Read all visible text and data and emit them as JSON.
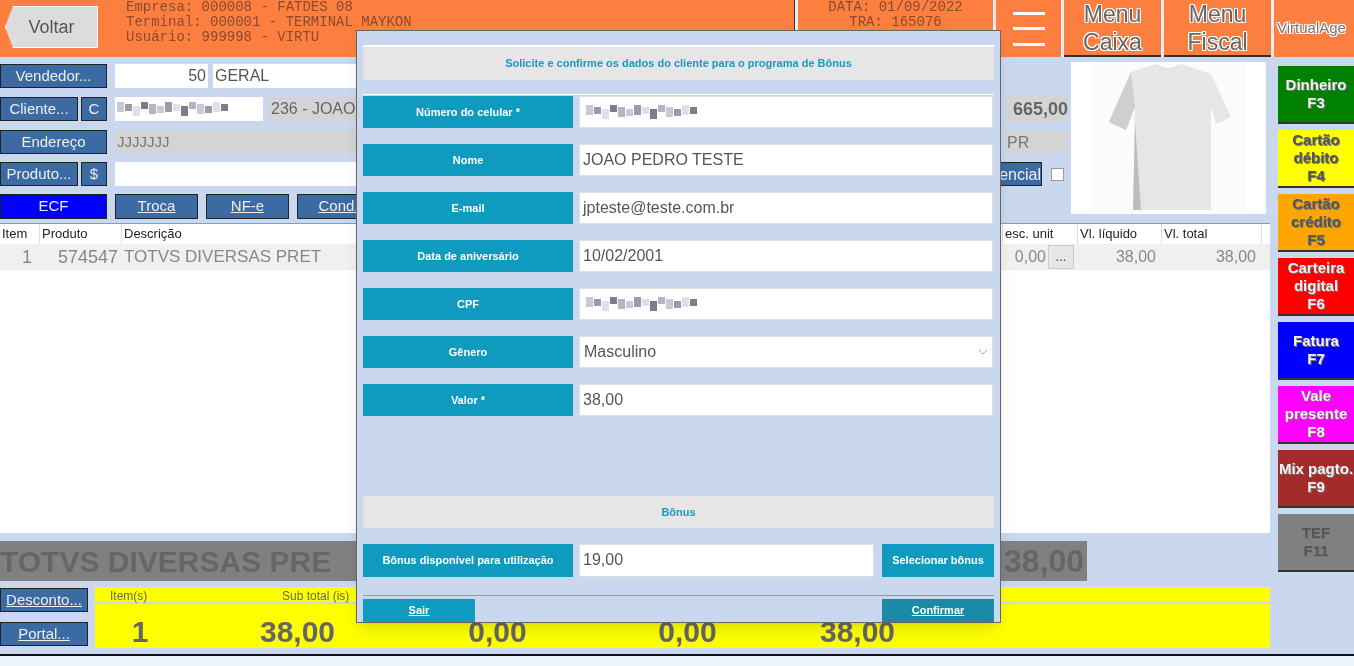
{
  "header": {
    "back": "Voltar",
    "info_lines": [
      "Empresa: 000008 - FATDES 08",
      "Terminal: 000001 - TERMINAL MAYKON",
      "Usuário: 999998 - VIRTU"
    ],
    "date_lines": [
      "DATA: 01/09/2022",
      "TRA: 165076"
    ],
    "menus": [
      "Menu Caixa",
      "Menu Fiscal"
    ],
    "app": "VirtualAge"
  },
  "form": {
    "seller_button": "Vendedor...",
    "seller_code": "50",
    "seller_name": "GERAL",
    "client_button": "Cliente...",
    "client_c": "C",
    "client_name": "236 - JOAO",
    "client_total": "665,00",
    "address_button": "Endereço",
    "address": "JJJJJJJ",
    "state": "PR",
    "product_button": "Produto...",
    "price_button": "$",
    "side_button": "encial",
    "side_checked": false
  },
  "doc_tabs": [
    {
      "label": "ECF",
      "selected": true
    },
    {
      "label": "Troca",
      "selected": false
    },
    {
      "label": "NF-e",
      "selected": false
    },
    {
      "label": "Cond.",
      "selected": false
    }
  ],
  "table": {
    "columns": [
      "Item",
      "Produto",
      "Descrição",
      "esc. unit",
      "Vl. líquido",
      "Vl. total"
    ],
    "rows": [
      {
        "item": "1",
        "code": "574547",
        "description": "TOTVS DIVERSAS PRET",
        "discount": "0,00",
        "more": "...",
        "net": "38,00",
        "total": "38,00"
      }
    ]
  },
  "current_item": {
    "description": "TOTVS DIVERSAS PRE",
    "total": "38,00"
  },
  "bottom_buttons": [
    "Desconto...",
    "Portal..."
  ],
  "totals": {
    "labels": [
      "Item(s)",
      "Sub total (is)"
    ],
    "values": [
      "1",
      "38,00",
      "0,00",
      "0,00",
      "38,00"
    ]
  },
  "payment_buttons": [
    {
      "label": "Dinheiro",
      "key": "F3",
      "color": "#008000"
    },
    {
      "label": "Cartão débito",
      "key": "F4",
      "color": "#ffff00"
    },
    {
      "label": "Cartão crédito",
      "key": "F5",
      "color": "#ffa500"
    },
    {
      "label": "Carteira digital",
      "key": "F6",
      "color": "#ff0000"
    },
    {
      "label": "Fatura",
      "key": "F7",
      "color": "#0000ff"
    },
    {
      "label": "Vale presente",
      "key": "F8",
      "color": "#ff00ff"
    },
    {
      "label": "Mix pagto.",
      "key": "F9",
      "color": "#a52a2a"
    },
    {
      "label": "TEF",
      "key": "F11",
      "color": "#808080"
    }
  ],
  "dialog": {
    "title": "Solicite e confirme os dados do cliente para o programa de Bônus",
    "fields": [
      {
        "label": "Número do celular *",
        "kind": "masked"
      },
      {
        "label": "Nome",
        "kind": "text",
        "value": "JOAO PEDRO TESTE"
      },
      {
        "label": "E-mail",
        "kind": "text",
        "value": "jpteste@teste.com.br"
      },
      {
        "label": "Data de aniversário",
        "kind": "text",
        "value": "10/02/2001"
      },
      {
        "label": "CPF",
        "kind": "masked"
      },
      {
        "label": "Gênero",
        "kind": "select",
        "value": "Masculino"
      },
      {
        "label": "Valor *",
        "kind": "text",
        "value": "38,00"
      }
    ],
    "bonus_section": "Bônus",
    "bonus_label": "Bônus disponível para utilização",
    "bonus_value": "19,00",
    "select_button": "Selecionar bônus",
    "cancel": "Sair",
    "confirm": "Confirmar"
  }
}
